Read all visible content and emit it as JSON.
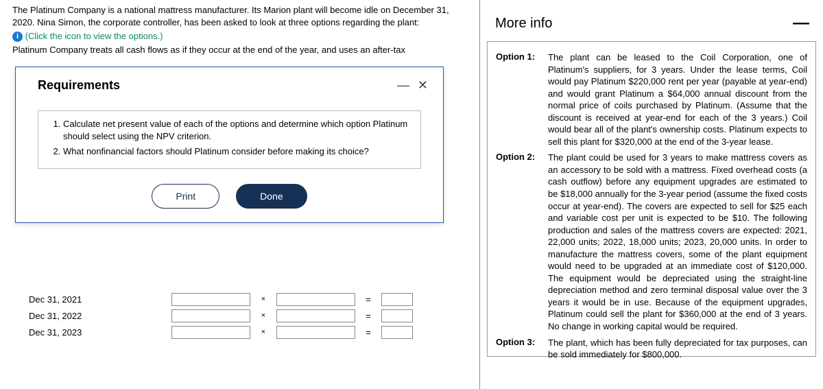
{
  "question": {
    "intro": "The Platinum Company is a national mattress manufacturer. Its Marion plant will become idle on December 31, 2020. Nina Simon, the corporate controller, has been asked to look at three options regarding the plant:",
    "click_icon": "(Click the icon to view the options.)",
    "treat_line": "Platinum Company treats all cash flows as if they occur at the end of the year, and uses an after-tax"
  },
  "requirements": {
    "title": "Requirements",
    "minimize": "—",
    "close": "✕",
    "items": [
      "Calculate net present value of each of the options and determine which option Platinum should select using the NPV criterion.",
      "What nonfinancial factors should Platinum consider before making its choice?"
    ],
    "print": "Print",
    "done": "Done"
  },
  "calc": {
    "rows": [
      {
        "date": "Dec 31, 2021",
        "x": "×",
        "eq": "="
      },
      {
        "date": "Dec 31, 2022",
        "x": "×",
        "eq": "="
      },
      {
        "date": "Dec 31, 2023",
        "x": "×",
        "eq": "="
      }
    ]
  },
  "more_info": {
    "title": "More info",
    "minimize": "—",
    "options": [
      {
        "label": "Option 1:",
        "text": "The plant can be leased to the Coil Corporation, one of Platinum's suppliers, for 3 years. Under the lease terms, Coil would pay Platinum $220,000 rent per year (payable at year-end) and would grant Platinum a $64,000 annual discount from the normal price of coils purchased by Platinum. (Assume that the discount is received at year-end for each of the 3 years.) Coil would bear all of the plant's ownership costs. Platinum expects to sell this plant for $320,000 at the end of the 3-year lease."
      },
      {
        "label": "Option 2:",
        "text": "The plant could be used for 3 years to make mattress covers as an accessory to be sold with a mattress. Fixed overhead costs (a cash outflow) before any equipment upgrades are estimated to be $18,000 annually for the 3-year period (assume the fixed costs occur at year-end). The covers are expected to sell for $25 each and variable cost per unit is expected to be $10. The following production and sales of the mattress covers are expected: 2021, 22,000 units; 2022, 18,000 units; 2023, 20,000 units. In order to manufacture the mattress covers, some of the plant equipment would need to be upgraded at an immediate cost of $120,000. The equipment would be depreciated using the straight-line depreciation method and zero terminal disposal value over the 3 years it would be in use. Because of the equipment upgrades, Platinum could sell the plant for $360,000 at the end of 3 years. No change in working capital would be required."
      },
      {
        "label": "Option 3:",
        "text": "The plant, which has been fully depreciated for tax purposes, can be sold immediately for $800,000."
      }
    ]
  }
}
